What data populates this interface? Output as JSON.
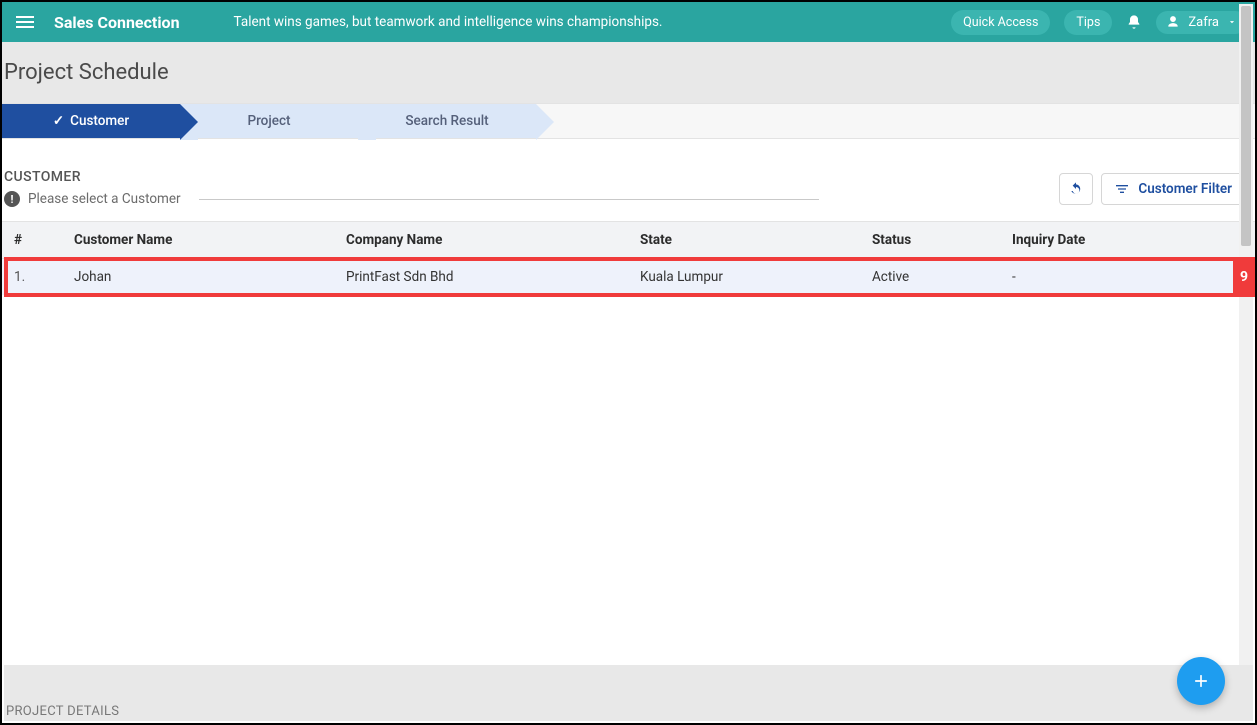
{
  "topbar": {
    "brand": "Sales Connection",
    "tagline": "Talent wins games, but teamwork and intelligence wins championships.",
    "quick_access": "Quick Access",
    "tips": "Tips",
    "user": "Zafra"
  },
  "page": {
    "title": "Project Schedule"
  },
  "steps": {
    "s1": "Customer",
    "s2": "Project",
    "s3": "Search Result"
  },
  "customer_section": {
    "title": "CUSTOMER",
    "instruction": "Please select a Customer",
    "filter_label": "Customer Filter"
  },
  "table": {
    "headers": {
      "idx": "#",
      "name": "Customer Name",
      "company": "Company Name",
      "state": "State",
      "status": "Status",
      "inquiry": "Inquiry Date"
    },
    "rows": [
      {
        "idx": "1.",
        "name": "Johan",
        "company": "PrintFast Sdn Bhd",
        "state": "Kuala Lumpur",
        "status": "Active",
        "inquiry": "-"
      }
    ],
    "annotation_badge": "9"
  },
  "footer": {
    "project_details": "PROJECT DETAILS"
  }
}
